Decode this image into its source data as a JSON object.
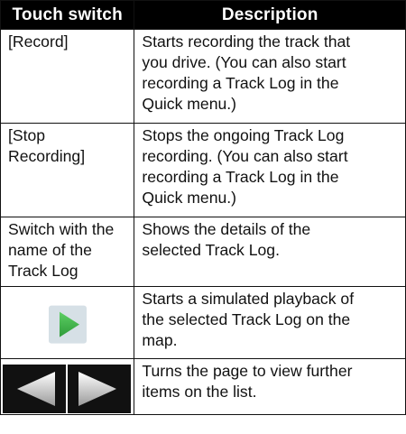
{
  "header": {
    "col1": "Touch switch",
    "col2": "Description"
  },
  "rows": [
    {
      "switch": "[Record]",
      "description": "Starts recording the track that\nyou drive. (You can also start\nrecording a Track Log in the\nQuick menu.)"
    },
    {
      "switch": "[Stop\nRecording]",
      "description": "Stops the ongoing Track Log\nrecording. (You can also start\nrecording a Track Log in the\nQuick menu.)"
    },
    {
      "switch": "Switch with the\nname of the\nTrack Log",
      "description": "Shows the details of the\nselected Track Log."
    },
    {
      "switch_icon": "play-icon",
      "description": "Starts a simulated playback of\nthe selected Track Log on the\nmap."
    },
    {
      "switch_icons": [
        "previous-arrow-icon",
        "next-arrow-icon"
      ],
      "description": "Turns the page to view further\nitems on the list."
    }
  ],
  "colors": {
    "header_bg": "#000000",
    "header_text": "#ffffff",
    "play_green": "#3fb54a",
    "nav_button_bg": "#111111"
  }
}
